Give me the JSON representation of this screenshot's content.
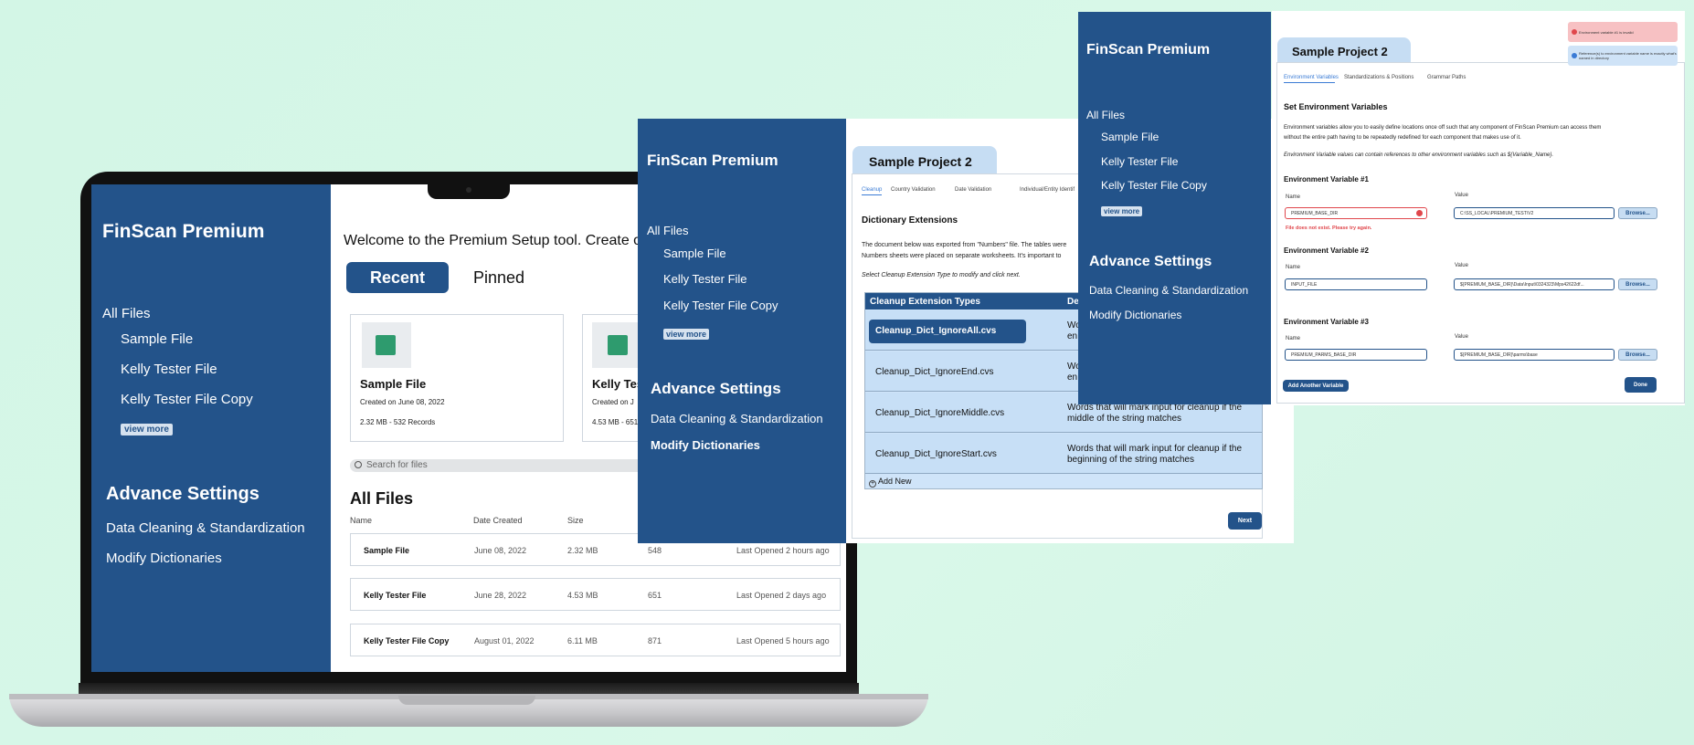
{
  "app": {
    "title": "FinScan Premium"
  },
  "sidebar": {
    "all_files": "All Files",
    "files": [
      "Sample File",
      "Kelly Tester File",
      "Kelly Tester File Copy"
    ],
    "view_more": "view more",
    "advance_settings": "Advance Settings",
    "settings": [
      "Data Cleaning & Standardization",
      "Modify Dictionaries"
    ]
  },
  "home": {
    "welcome": "Welcome to the Premium Setup tool. Create or",
    "tabs": {
      "recent": "Recent",
      "pinned": "Pinned"
    },
    "cards": [
      {
        "name": "Sample File",
        "created": "Created on June 08, 2022",
        "meta": "2.32 MB - 532 Records"
      },
      {
        "name": "Kelly Tes",
        "created": "Created on J",
        "meta": "4.53 MB - 651"
      }
    ],
    "search": {
      "placeholder": "Search for files"
    },
    "all_files_heading": "All Files",
    "columns": {
      "name": "Name",
      "date": "Date Created",
      "size": "Size"
    },
    "rows": [
      {
        "name": "Sample File",
        "date": "June 08, 2022",
        "size": "2.32 MB",
        "count": "548",
        "opened": "Last Opened 2 hours ago"
      },
      {
        "name": "Kelly Tester File",
        "date": "June 28, 2022",
        "size": "4.53 MB",
        "count": "651",
        "opened": "Last Opened 2 days ago"
      },
      {
        "name": "Kelly Tester File Copy",
        "date": "August 01, 2022",
        "size": "6.11 MB",
        "count": "871",
        "opened": "Last Opened 5 hours ago"
      }
    ]
  },
  "project": {
    "name": "Sample Project 2",
    "tabs": [
      "Cleanup",
      "Country Validation",
      "Date Validation",
      "Individual/Entity Identif"
    ],
    "heading": "Dictionary Extensions",
    "para1": "The document below was exported from \"Numbers\" file. The tables were",
    "para2": "Numbers sheets were placed on separate worksheets. It's important to",
    "instruction": "Select Cleanup Extension Type to modify and click next.",
    "table": {
      "col1": "Cleanup Extension Types",
      "col2": "De",
      "rows": [
        {
          "name": "Cleanup_Dict_IgnoreAll.cvs",
          "desc1": "Words",
          "desc2": "en"
        },
        {
          "name": "Cleanup_Dict_IgnoreEnd.cvs",
          "desc1": "Wor",
          "desc2": "en"
        },
        {
          "name": "Cleanup_Dict_IgnoreMiddle.cvs",
          "desc1": "Words that will mark input for cleanup if the",
          "desc2": "middle of the string matches"
        },
        {
          "name": "Cleanup_Dict_IgnoreStart.cvs",
          "desc1": "Words that will mark input for cleanup if the",
          "desc2": "beginning of the string matches"
        }
      ],
      "add_new": "Add New"
    },
    "next": "Next"
  },
  "env": {
    "tabs": [
      "Environment Variables",
      "Standardizations & Positions",
      "Grammar Paths"
    ],
    "heading": "Set Environment Variables",
    "para1": "Environment variables allow you to easily define locations once off such that any component of FinScan Premium can access them",
    "para2": "without the entire path having to be repeatedly redefined for each component that makes use of it.",
    "note": "Environment Variable values can contain references to other environment variables such as ${Variable_Name}.",
    "name_label": "Name",
    "value_label": "Value",
    "browse": "Browse...",
    "vars": [
      {
        "title": "Environment Variable #1",
        "name": "PREMIUM_BASE_DIR",
        "value": "C:\\SS_LOCAL\\PREMIUM_TEST\\V2",
        "error": "File does not exist. Please try again."
      },
      {
        "title": "Environment Variable #2",
        "name": "INPUT_FILE",
        "value": "${PREMIUM_BASE_DIR}\\Data\\Input\\0324323\\Mps42622df...",
        "error": ""
      },
      {
        "title": "Environment Variable #3",
        "name": "PREMIUM_PARMS_BASE_DIR",
        "value": "${PREMIUM_BASE_DIR}\\parms\\base",
        "error": ""
      }
    ],
    "add_variable": "Add Another Variable",
    "done": "Done",
    "toast_error": "Environment variable #1 is invalid",
    "toast_info": "Reference(s) to environment variable name is exactly what's named in directory"
  },
  "colors": {
    "navy": "#23538a",
    "light_blue": "#c6ddf3",
    "background": "#d3f6e6",
    "error": "#e0474c",
    "success_green": "#2e9b6e"
  }
}
